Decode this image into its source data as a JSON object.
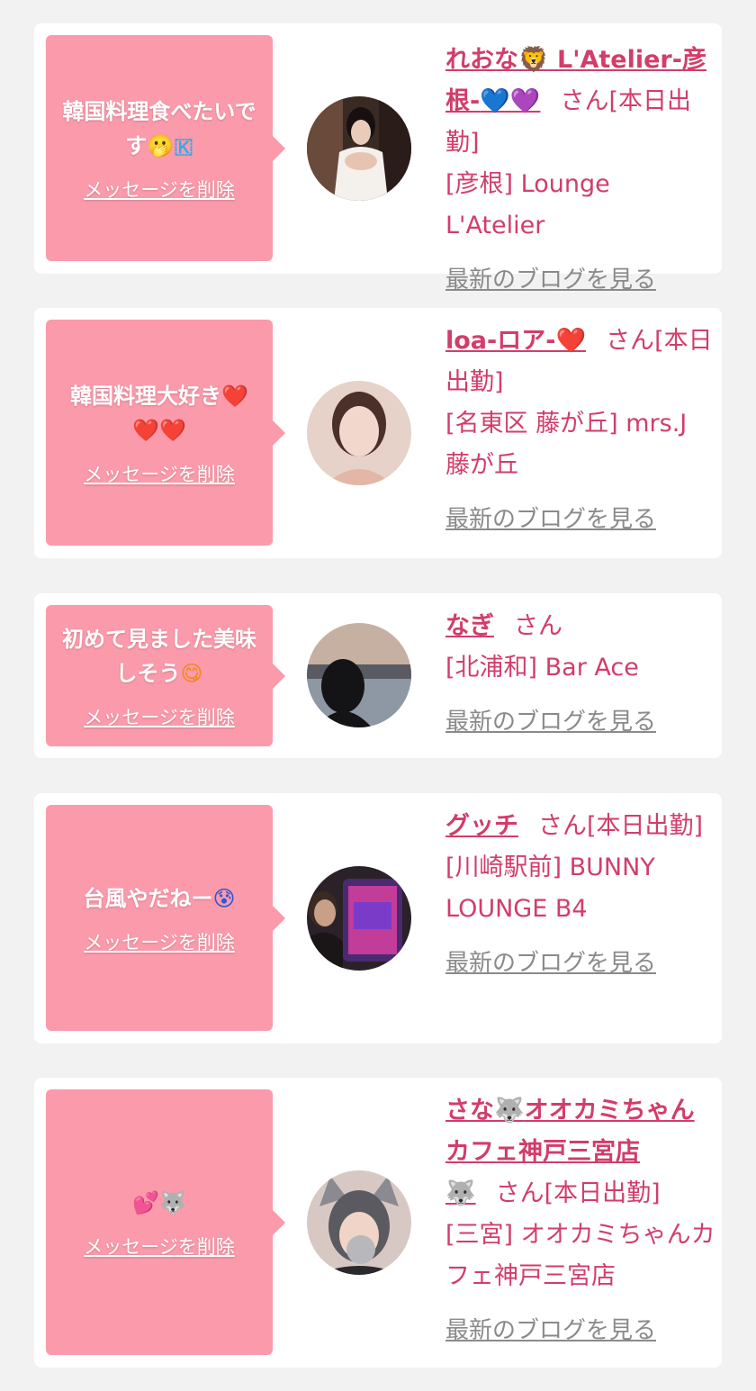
{
  "delete_label": "メッセージを削除",
  "blog_label": "最新のブログを見る",
  "san_label": "さん",
  "colors": {
    "background": "#f2f2f2",
    "card": "#ffffff",
    "bubble": "#fb9aaa",
    "accent_text": "#d23d6a",
    "link_gray": "#8a8a8a"
  },
  "messages": [
    {
      "message_text": "韓国料理食べたいです",
      "message_emoji": [
        "🫢",
        "🇰"
      ],
      "name_text": "れおな",
      "name_emoji_1": "🦁",
      "name_text_2": " L'Atelier-彦根-",
      "name_emoji_2": "💙💜",
      "status": "[本日出勤]",
      "shop": "[彦根] Lounge L'Atelier"
    },
    {
      "message_text": "韓国料理大好き",
      "message_emoji": [
        "❤️",
        "❤️❤️"
      ],
      "name_text": "loa-ロア-",
      "name_emoji_1": "❤️",
      "status": "[本日出勤]",
      "shop": "[名東区 藤が丘] mrs.J 藤が丘"
    },
    {
      "message_text": "初めて見ました美味しそう",
      "message_emoji": [
        "😋"
      ],
      "name_text": "なぎ",
      "status": "",
      "shop": "[北浦和] Bar Ace"
    },
    {
      "message_text": "台風やだねー",
      "message_emoji": [
        "😰"
      ],
      "name_text": "グッチ",
      "status": "[本日出勤]",
      "shop": "[川崎駅前] BUNNY LOUNGE B4"
    },
    {
      "message_text": "",
      "message_emoji": [
        "💕",
        "🐺"
      ],
      "name_text": "さな",
      "name_emoji_1": "🐺",
      "name_text_2": "オオカミちゃんカフェ神戸三宮店",
      "name_emoji_2": "🐺",
      "status": "[本日出勤]",
      "shop": "[三宮] オオカミちゃんカフェ神戸三宮店"
    }
  ]
}
